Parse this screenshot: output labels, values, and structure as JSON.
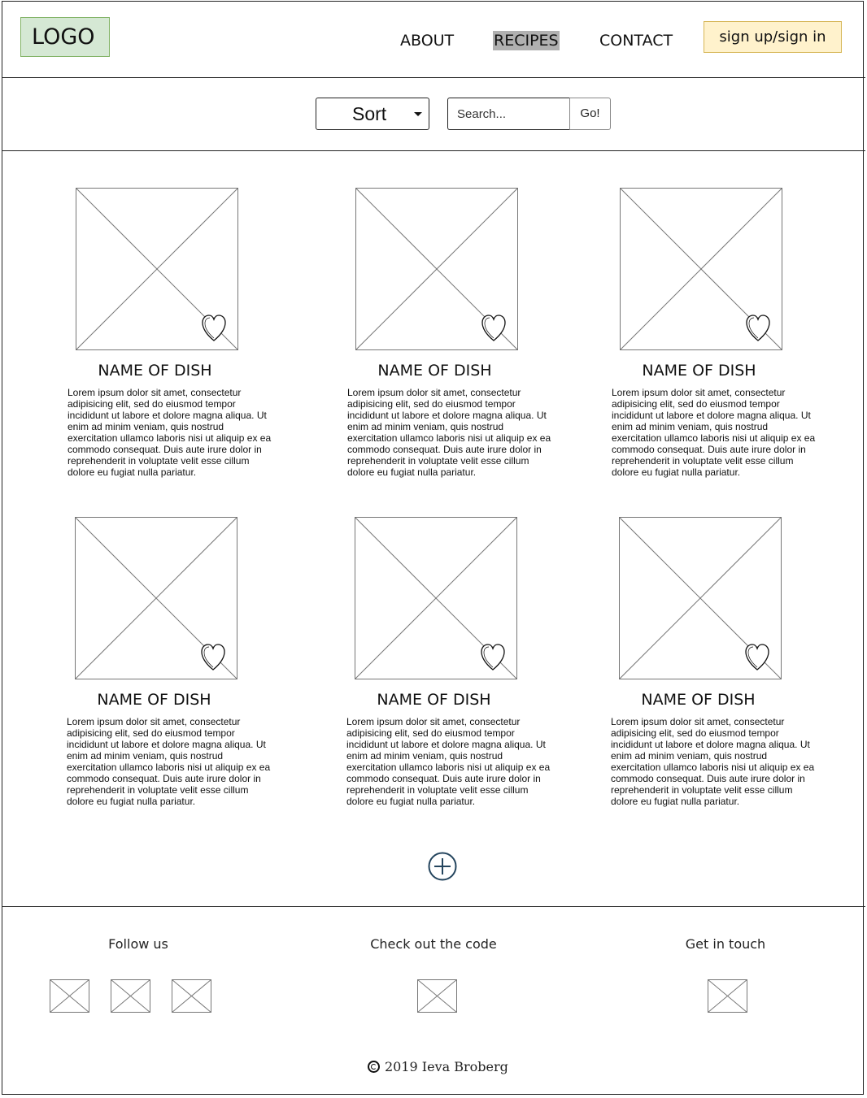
{
  "header": {
    "logo": "LOGO",
    "nav": [
      "ABOUT",
      "RECIPES",
      "CONTACT"
    ],
    "active_nav": "RECIPES",
    "signup": "sign up/sign in"
  },
  "toolbar": {
    "sort_label": "Sort",
    "search_placeholder": "Search...",
    "go_label": "Go!"
  },
  "recipes": [
    {
      "name": "NAME OF DISH",
      "description": "Lorem ipsum dolor sit amet, consectetur adipisicing elit, sed do eiusmod tempor incididunt ut labore et dolore magna aliqua. Ut enim ad minim veniam, quis nostrud exercitation ullamco laboris nisi ut aliquip ex ea commodo consequat. Duis aute irure dolor in reprehenderit in voluptate velit esse cillum dolore eu fugiat nulla pariatur."
    },
    {
      "name": "NAME OF DISH",
      "description": "Lorem ipsum dolor sit amet, consectetur adipisicing elit, sed do eiusmod tempor incididunt ut labore et dolore magna aliqua. Ut enim ad minim veniam, quis nostrud exercitation ullamco laboris nisi ut aliquip ex ea commodo consequat. Duis aute irure dolor in reprehenderit in voluptate velit esse cillum dolore eu fugiat nulla pariatur."
    },
    {
      "name": "NAME OF DISH",
      "description": "Lorem ipsum dolor sit amet, consectetur adipisicing elit, sed do eiusmod tempor incididunt ut labore et dolore magna aliqua. Ut enim ad minim veniam, quis nostrud exercitation ullamco laboris nisi ut aliquip ex ea commodo consequat. Duis aute irure dolor in reprehenderit in voluptate velit esse cillum dolore eu fugiat nulla pariatur."
    },
    {
      "name": "NAME OF DISH",
      "description": "Lorem ipsum dolor sit amet, consectetur adipisicing elit, sed do eiusmod tempor incididunt ut labore et dolore magna aliqua. Ut enim ad minim veniam, quis nostrud exercitation ullamco laboris nisi ut aliquip ex ea commodo consequat. Duis aute irure dolor in reprehenderit in voluptate velit esse cillum dolore eu fugiat nulla pariatur."
    },
    {
      "name": "NAME OF DISH",
      "description": "Lorem ipsum dolor sit amet, consectetur adipisicing elit, sed do eiusmod tempor incididunt ut labore et dolore magna aliqua. Ut enim ad minim veniam, quis nostrud exercitation ullamco laboris nisi ut aliquip ex ea commodo consequat. Duis aute irure dolor in reprehenderit in voluptate velit esse cillum dolore eu fugiat nulla pariatur."
    },
    {
      "name": "NAME OF DISH",
      "description": "Lorem ipsum dolor sit amet, consectetur adipisicing elit, sed do eiusmod tempor incididunt ut labore et dolore magna aliqua. Ut enim ad minim veniam, quis nostrud exercitation ullamco laboris nisi ut aliquip ex ea commodo consequat. Duis aute irure dolor in reprehenderit in voluptate velit esse cillum dolore eu fugiat nulla pariatur."
    }
  ],
  "footer": {
    "follow_title": "Follow us",
    "code_title": "Check out the code",
    "contact_title": "Get in touch",
    "copyright": "2019 Ieva Broberg"
  },
  "icons": {
    "favorite": "heart-icon",
    "add_more": "plus-circle-icon",
    "placeholder": "image-placeholder-icon"
  },
  "colors": {
    "logo_bg": "#d5e8d4",
    "signup_bg": "#fff2cc",
    "active_nav_bg": "#b0b0b0",
    "add_icon": "#23445d"
  }
}
